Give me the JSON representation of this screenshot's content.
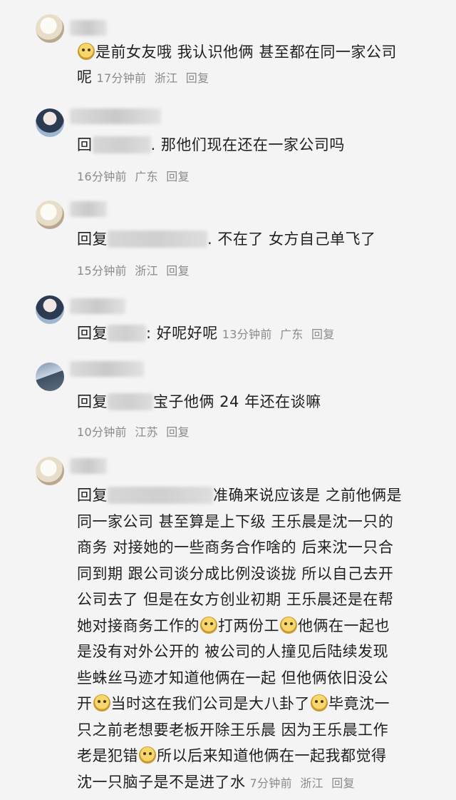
{
  "comments": [
    {
      "id": "c1",
      "text_before": "是前女友哦 我认识他俩 甚至都在同一家公司",
      "text_line2": "呢",
      "time": "17分钟前",
      "location": "浙江",
      "reply": "回复",
      "avatar_icon": "pet-avatar-icon"
    },
    {
      "id": "c2",
      "prefix": "回",
      "text": ". 那他们现在还在一家公司吗",
      "time": "16分钟前",
      "location": "广东",
      "reply": "回复",
      "avatar_icon": "girl-avatar-icon"
    },
    {
      "id": "c3",
      "prefix": "回复",
      "text": ". 不在了 女方自己单飞了",
      "time": "15分钟前",
      "location": "浙江",
      "reply": "回复",
      "avatar_icon": "pet-avatar-icon"
    },
    {
      "id": "c4",
      "prefix": "回复",
      "text": ": 好呢好呢",
      "time": "13分钟前",
      "location": "广东",
      "reply": "回复",
      "avatar_icon": "girl-avatar-icon"
    },
    {
      "id": "c5",
      "prefix": "回复",
      "text": "宝子他俩 24 年还在谈嘛",
      "time": "10分钟前",
      "location": "江苏",
      "reply": "回复",
      "avatar_icon": "sky-avatar-icon"
    },
    {
      "id": "c6",
      "prefix": "回复",
      "lines": [
        "准确来说应该是 之前他俩是",
        "同一家公司 甚至算是上下级 王乐晨是沈一只的",
        "商务 对接她的一些商务合作啥的 后来沈一只合",
        "同到期 跟公司谈分成比例没谈拢 所以自己去开",
        "公司去了 但是在女方创业初期 王乐晨还是在帮"
      ],
      "line6_a": "她对接商务工作的",
      "line6_b": "打两份工",
      "line6_c": "他俩在一起也",
      "line7": "是没有对外公开的 被公司的人撞见后陆续发现",
      "line8": "些蛛丝马迹才知道他俩在一起 但他俩依旧没公",
      "line9_a": "开",
      "line9_b": "当时这在我们公司是大八卦了",
      "line9_c": "毕竟沈一",
      "line10": "只之前老想要老板开除王乐晨 因为王乐晨工作",
      "line11_a": "老是犯错",
      "line11_b": "所以后来知道他俩在一起我都觉得",
      "line12": "沈一只脑子是不是进了水",
      "time": "7分钟前",
      "location": "浙江",
      "reply": "回复",
      "avatar_icon": "pet-avatar-icon"
    }
  ]
}
